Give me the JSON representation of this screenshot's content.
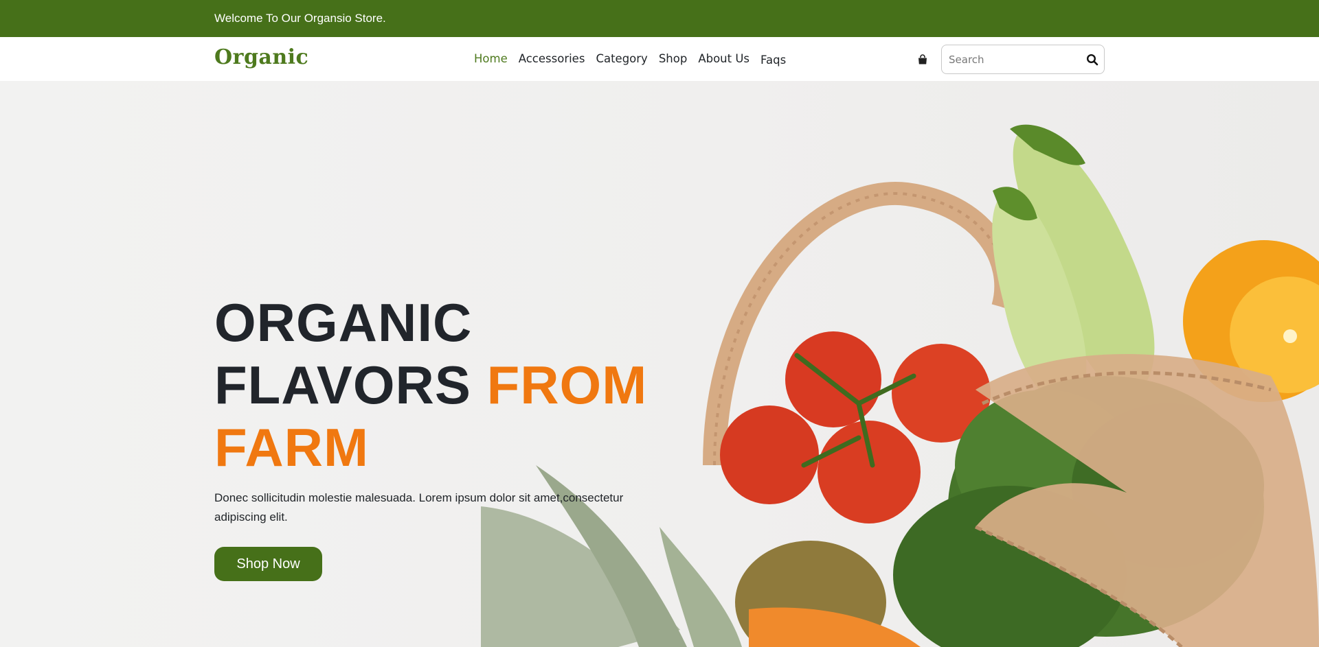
{
  "topbar": {
    "welcome": "Welcome To Our Organsio Store."
  },
  "header": {
    "logo": "Organic",
    "nav": [
      "Home",
      "Accessories",
      "Category",
      "Shop",
      "About Us",
      "Faqs"
    ],
    "active_nav": "Home",
    "search_placeholder": "Search"
  },
  "hero": {
    "line1": "ORGANIC",
    "line2_dark": "FLAVORS",
    "line2_accent": "FROM",
    "line3_accent": "FARM",
    "description": "Donec sollicitudin molestie malesuada. Lorem ipsum dolor sit amet,consectetur adipiscing elit.",
    "cta": "Shop Now"
  },
  "colors": {
    "brand_green": "#467019",
    "accent_orange": "#f07810",
    "heading_dark": "#21252b"
  },
  "icons": [
    "shopping-bag-icon",
    "search-icon"
  ]
}
